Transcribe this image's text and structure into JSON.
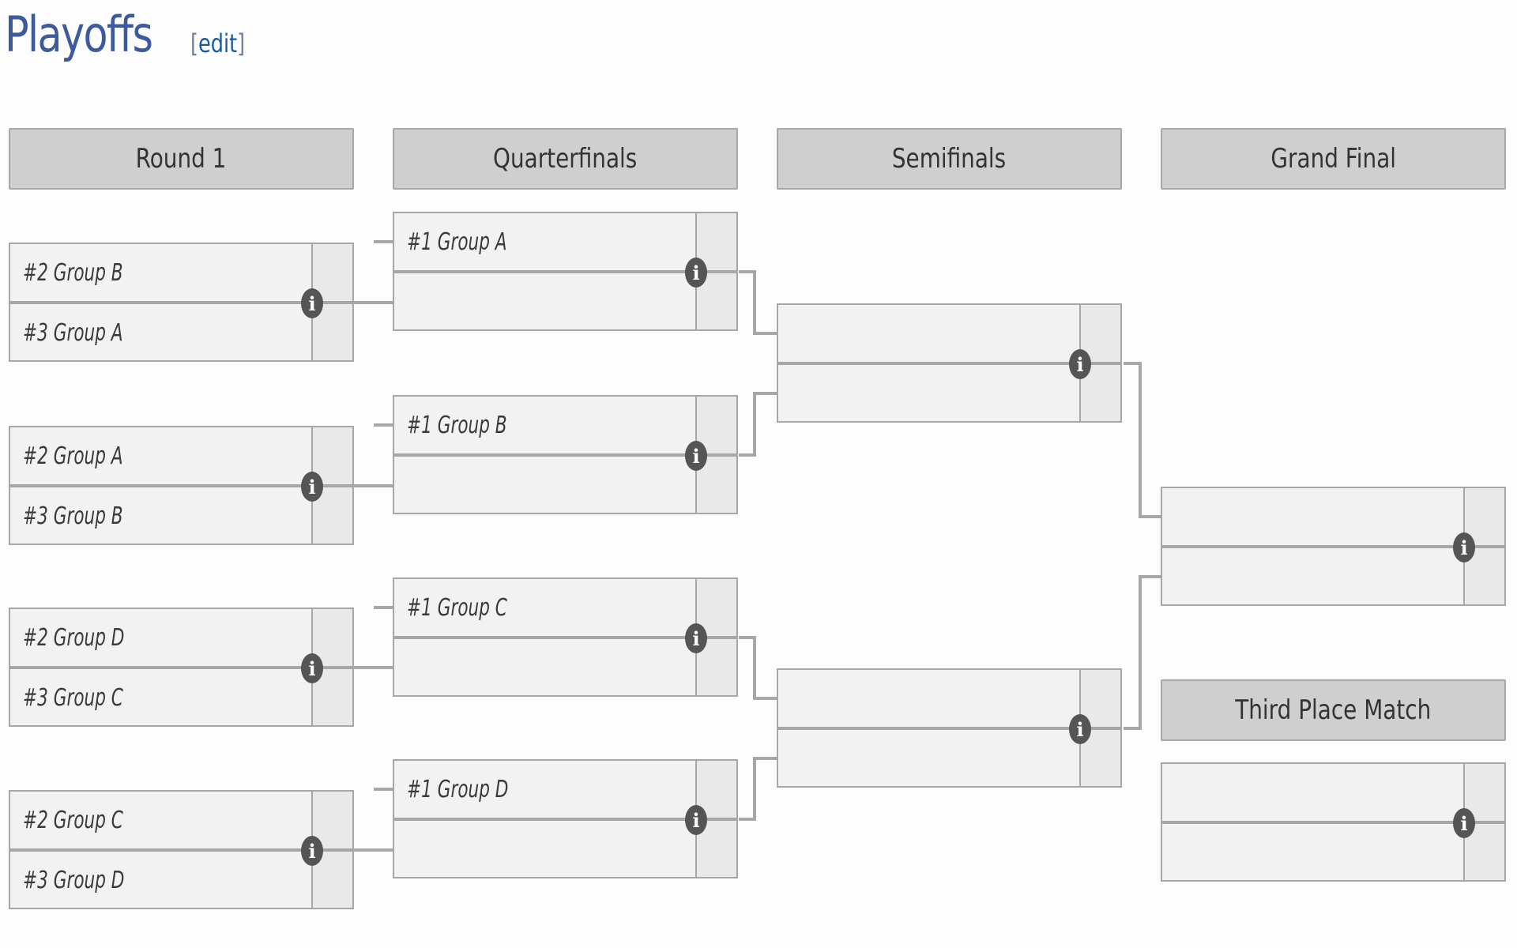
{
  "page": {
    "title": "Playoffs",
    "edit_open": "[",
    "edit_label": "edit",
    "edit_close": "]"
  },
  "rounds": [
    {
      "label": "Round 1"
    },
    {
      "label": "Quarterfinals"
    },
    {
      "label": "Semifinals"
    },
    {
      "label": "Grand Final"
    }
  ],
  "third_place": {
    "label": "Third Place Match"
  },
  "matches": {
    "round1": [
      {
        "top": "#2 Group B",
        "bottom": "#3 Group A"
      },
      {
        "top": "#2 Group A",
        "bottom": "#3 Group B"
      },
      {
        "top": "#2 Group D",
        "bottom": "#3 Group C"
      },
      {
        "top": "#2 Group C",
        "bottom": "#3 Group D"
      }
    ],
    "quarterfinals": [
      {
        "top": "#1 Group A",
        "bottom": ""
      },
      {
        "top": "#1 Group B",
        "bottom": ""
      },
      {
        "top": "#1 Group C",
        "bottom": ""
      },
      {
        "top": "#1 Group D",
        "bottom": ""
      }
    ],
    "semifinals": [
      {
        "top": "",
        "bottom": ""
      },
      {
        "top": "",
        "bottom": ""
      }
    ],
    "grand_final": [
      {
        "top": "",
        "bottom": ""
      }
    ],
    "third_place": [
      {
        "top": "",
        "bottom": ""
      }
    ]
  },
  "icons": {
    "info": "i"
  },
  "colors": {
    "title": "#3c5a9e",
    "link": "#1b5a9a",
    "header_bg": "#cfcfcf",
    "match_bg": "#f2f2f2",
    "border": "#a7a7a7",
    "info_icon": "#555555"
  }
}
